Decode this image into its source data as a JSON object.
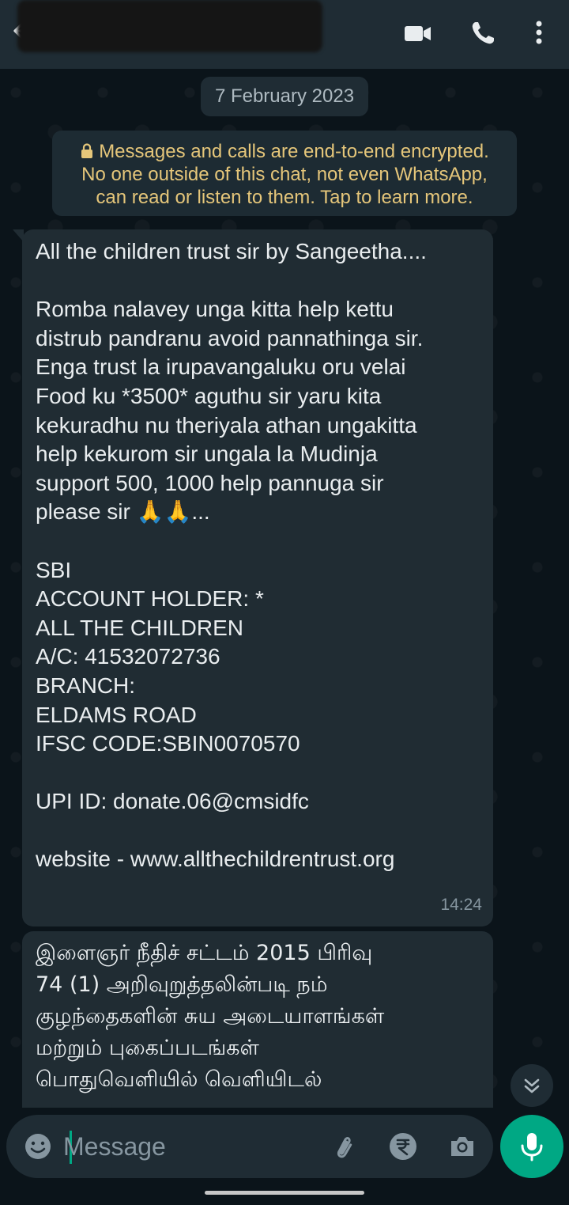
{
  "header": {
    "back_icon": "arrow-left-icon",
    "video_icon": "video-camera-icon",
    "call_icon": "phone-icon",
    "menu_icon": "more-vertical-icon"
  },
  "chat": {
    "date_chip": "7 February 2023",
    "encryption_notice": {
      "lines": [
        "Messages and calls are end-to-end encrypted.",
        "No one outside of this chat, not even WhatsApp,",
        "can read or listen to them. Tap to learn more."
      ]
    },
    "messages": [
      {
        "lines": [
          "All the children trust sir by Sangeetha....",
          "",
          "Romba nalavey unga kitta help kettu",
          "distrub pandranu avoid pannathinga sir.",
          "Enga trust la irupavangaluku oru velai",
          "Food ku *3500* aguthu sir yaru kita",
          "kekuradhu nu theriyala athan ungakitta",
          "help kekurom sir ungala la Mudinja",
          "support 500, 1000 help pannuga sir",
          "please sir 🙏🙏...",
          "",
          "SBI",
          "ACCOUNT HOLDER: *",
          "ALL THE CHILDREN",
          "A/C: 41532072736",
          "BRANCH:",
          "ELDAMS ROAD",
          "IFSC CODE:SBIN0070570",
          "",
          "UPI ID: donate.06@cmsidfc",
          "",
          "website - www.allthechildrentrust.org"
        ],
        "time": "14:24"
      },
      {
        "lines": [
          "இளைஞர் நீதிச் சட்டம் 2015 பிரிவு",
          "74 (1) அறிவுறுத்தலின்படி நம்",
          "குழந்தைகளின் சுய அடையாளங்கள்",
          "மற்றும் புகைப்படங்கள்",
          "பொதுவெளியில் வெளியிடல்"
        ]
      }
    ]
  },
  "input_bar": {
    "placeholder": "Message",
    "emoji_icon": "smiley-icon",
    "attach_icon": "paperclip-icon",
    "payment_icon": "rupee-icon",
    "camera_icon": "camera-icon",
    "mic_icon": "microphone-icon"
  },
  "colors": {
    "header_bg": "#1f2c34",
    "chat_bg": "#0b141a",
    "bubble_bg": "#202c33",
    "encryption_text": "#e5c67a",
    "accent": "#00a884"
  }
}
